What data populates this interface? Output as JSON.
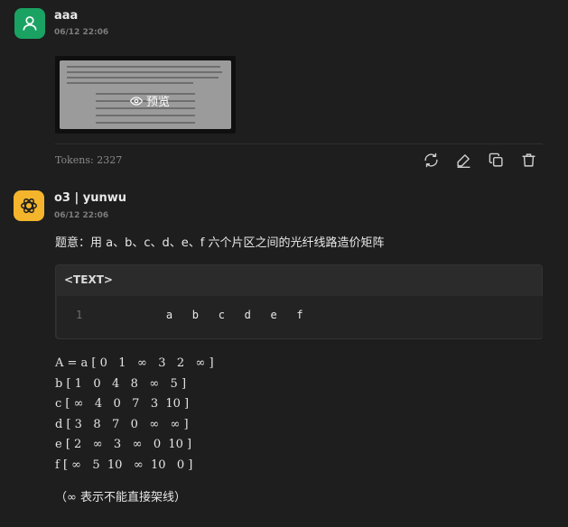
{
  "user_message": {
    "avatar_icon": "user-icon",
    "avatar_color": "#1aa262",
    "name": "aaa",
    "time": "06/12 22:06",
    "image_preview_label": "预览",
    "tokens": "Tokens: 2327",
    "actions": [
      "refresh-icon",
      "edit-icon",
      "copy-icon",
      "delete-icon"
    ]
  },
  "bot_message": {
    "avatar_icon": "openai-icon",
    "avatar_color": "#f4b52c",
    "name": "o3 | yunwu",
    "time": "06/12 22:06",
    "question": "题意：用 a、b、c、d、e、f 六个片区之间的光纤线路造价矩阵",
    "code": {
      "lang": "<TEXT>",
      "line_number": "1",
      "text": "    a   b   c   d   e   f"
    },
    "matrix_rows": [
      "A = a [ 0   1   ∞   3   2   ∞ ]",
      "b [ 1   0   4   8   ∞   5 ]",
      "c [ ∞   4   0   7   3  10 ]",
      "d [ 3   8   7   0   ∞   ∞ ]",
      "e [ 2   ∞   3   ∞   0  10 ]",
      "f [ ∞   5  10   ∞  10   0 ]"
    ],
    "footnote": "（∞ 表示不能直接架线）"
  }
}
